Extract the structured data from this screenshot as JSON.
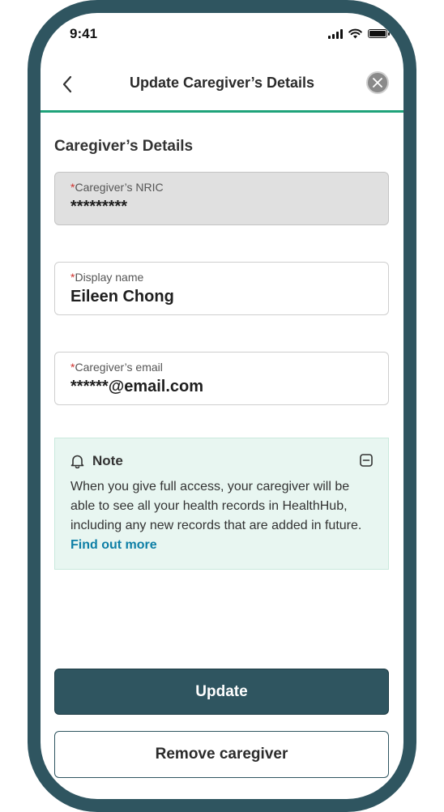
{
  "status_bar": {
    "time": "9:41"
  },
  "header": {
    "title": "Update Caregiver’s Details"
  },
  "section": {
    "title": "Caregiver’s Details"
  },
  "fields": {
    "nric": {
      "required_mark": "*",
      "label": "Caregiver’s NRIC",
      "value": "*********"
    },
    "display_name": {
      "required_mark": "*",
      "label": "Display name",
      "value": "Eileen Chong"
    },
    "email": {
      "required_mark": "*",
      "label": "Caregiver’s email",
      "value": "******@email.com"
    }
  },
  "note": {
    "title": "Note",
    "text": "When you give full access, your caregiver will be able to see all your health records in HealthHub, including any new records that are added in future.",
    "link": "Find out more"
  },
  "buttons": {
    "update": "Update",
    "remove": "Remove caregiver"
  },
  "colors": {
    "brand": "#2f5560",
    "accent": "#1fa37a",
    "link": "#0e7fa6",
    "required": "#d0312d",
    "note_bg": "#e8f6f1"
  },
  "icons": {
    "back": "chevron-left-icon",
    "close": "close-icon",
    "note": "bell-icon",
    "collapse": "minus-square-icon"
  }
}
